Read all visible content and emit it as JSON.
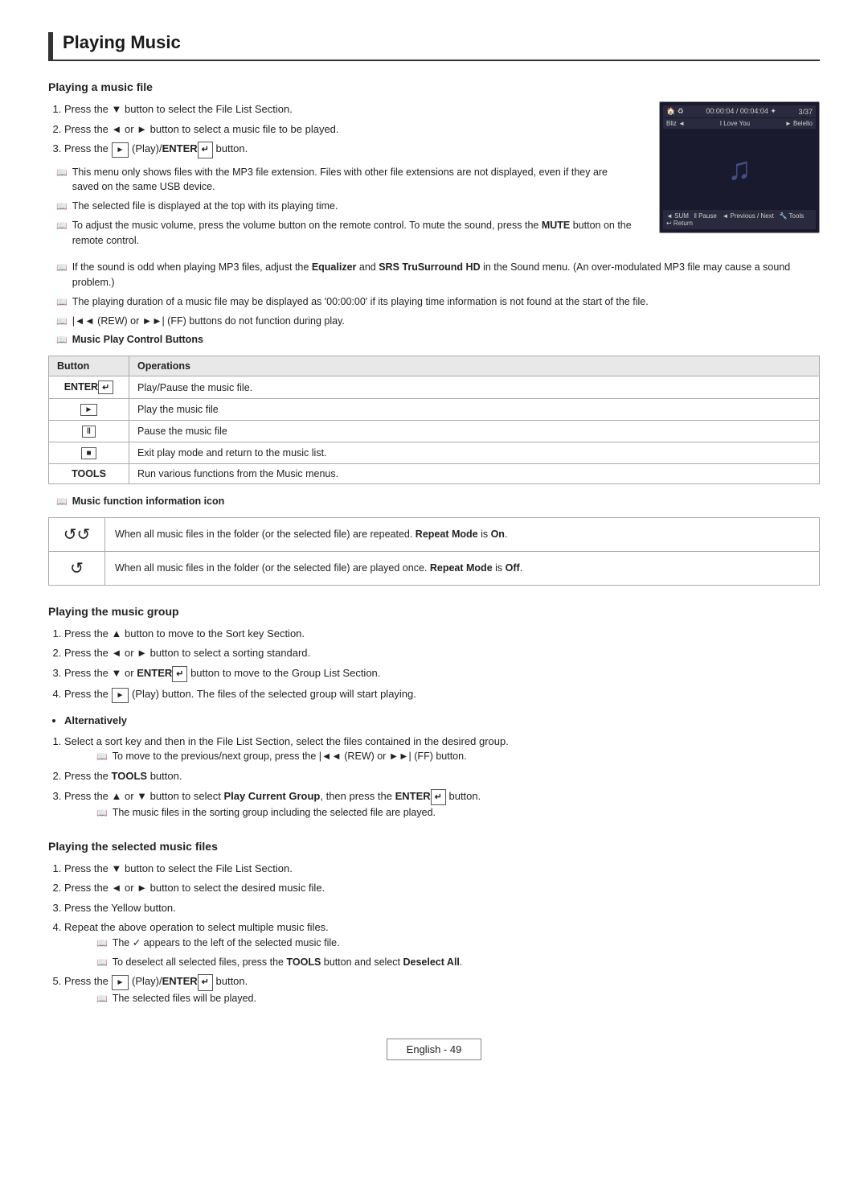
{
  "page": {
    "title": "Playing Music",
    "footer": "English - 49"
  },
  "sections": {
    "playing_music_file": {
      "title": "Playing a music file",
      "steps": [
        "Press the ▼ button to select the File List Section.",
        "Press the ◄ or ► button to select a music file to be played.",
        "Press the [►] (Play)/ENTER↵ button."
      ],
      "notes": [
        "This menu only shows files with the MP3 file extension. Files with other file extensions are not displayed, even if they are saved on the same USB device.",
        "The selected file is displayed at the top with its playing time.",
        "To adjust the music volume, press the volume button on the remote control. To mute the sound, press the MUTE button on the remote control.",
        "If the sound is odd when playing MP3 files, adjust the Equalizer and SRS TruSurround HD in the Sound menu. (An over-modulated MP3 file may cause a sound problem.)",
        "The playing duration of a music file may be displayed as '00:00:00' if its playing time information is not found at the start of the file.",
        "◄◄ (REW) or ►►| (FF) buttons do not function during play."
      ],
      "table_label": "Music Play Control Buttons",
      "table_headers": [
        "Button",
        "Operations"
      ],
      "table_rows": [
        [
          "ENTER↵",
          "Play/Pause the music file."
        ],
        [
          "►",
          "Play the music file"
        ],
        [
          "II",
          "Pause the music file"
        ],
        [
          "■",
          "Exit play mode and return to the music list."
        ],
        [
          "TOOLS",
          "Run various functions from the Music menus."
        ]
      ],
      "icon_label": "Music function information icon",
      "icon_rows": [
        [
          "↺↺",
          "When all music files in the folder (or the selected file) are repeated. Repeat Mode is On."
        ],
        [
          "↺",
          "When all music files in the folder (or the selected file) are played once. Repeat Mode is Off."
        ]
      ]
    },
    "playing_music_group": {
      "title": "Playing the music group",
      "steps": [
        "Press the ▲ button to move to the Sort key Section.",
        "Press the ◄ or ► button to select a sorting standard.",
        "Press the ▼ or ENTER↵ button to move to the Group List Section.",
        "Press the [►] (Play) button. The files of the selected group will start playing."
      ],
      "alternatively_label": "Alternatively",
      "alt_steps": [
        "Select a sort key and then in the File List Section, select the files contained in the desired group.",
        "Press the TOOLS button.",
        "Press the ▲ or ▼ button to select Play Current Group, then press the ENTER↵ button."
      ],
      "alt_notes": [
        "To move to the previous/next group, press the ◄◄ (REW) or ►►| (FF) button.",
        "The music files in the sorting group including the selected file are played."
      ]
    },
    "playing_selected_files": {
      "title": "Playing the selected music files",
      "steps": [
        "Press the ▼ button to select the File List Section.",
        "Press the ◄ or ► button to select the desired music file.",
        "Press the Yellow button.",
        "Repeat the above operation to select multiple music files.",
        "Press the [►] (Play)/ENTER↵ button."
      ],
      "notes_step4": [
        "The ✓ appears to the left of the selected music file.",
        "To deselect all selected files, press the TOOLS button and select Deselect All."
      ],
      "note_step5": "The selected files will be played."
    }
  },
  "player": {
    "time_current": "00:00:04",
    "time_total": "00:04:04",
    "track_number": "3/37",
    "prev_track": "Bliz",
    "current_track": "I Love You",
    "next_track": "Belello",
    "controls": "◄◄ Pause ◄◄ Previous / Next   Tools   Return"
  }
}
